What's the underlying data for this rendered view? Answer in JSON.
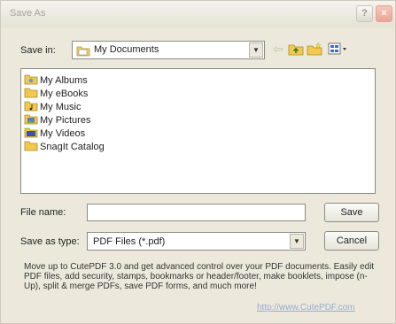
{
  "window": {
    "title": "Save As"
  },
  "titlebar": {
    "help_glyph": "?",
    "close_glyph": "×"
  },
  "savein": {
    "label": "Save in:",
    "value": "My Documents"
  },
  "toolbar": {
    "back_glyph": "⇦"
  },
  "files": [
    {
      "name": "My Albums",
      "icon": "album-folder-icon"
    },
    {
      "name": "My eBooks",
      "icon": "folder-icon"
    },
    {
      "name": "My Music",
      "icon": "music-folder-icon"
    },
    {
      "name": "My Pictures",
      "icon": "pictures-folder-icon"
    },
    {
      "name": "My Videos",
      "icon": "videos-folder-icon"
    },
    {
      "name": "SnagIt Catalog",
      "icon": "folder-icon"
    }
  ],
  "filename": {
    "label": "File name:",
    "value": ""
  },
  "savetype": {
    "label": "Save as type:",
    "value": "PDF Files (*.pdf)"
  },
  "buttons": {
    "save": "Save",
    "cancel": "Cancel"
  },
  "promo": {
    "text": "Move up to CutePDF 3.0 and get advanced control over your PDF documents. Easily edit PDF files, add security, stamps, bookmarks or header/footer, make booklets, impose (n-Up), split & merge PDFs, save PDF forms, and much more!",
    "link": "http://www.CutePDF.com"
  },
  "colors": {
    "folder": "#f2c94c",
    "dialog_bg": "#ece9dc",
    "link": "#9aa8cf"
  }
}
